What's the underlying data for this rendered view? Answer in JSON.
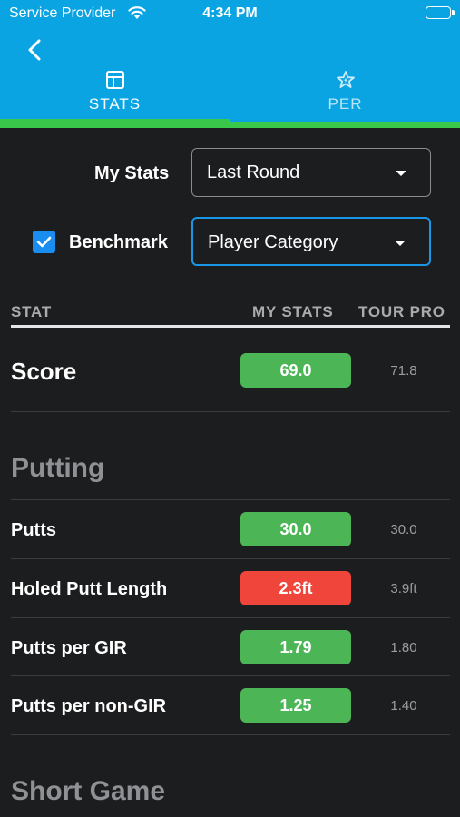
{
  "status_bar": {
    "carrier": "Service Provider",
    "time": "4:34 PM"
  },
  "tabs": [
    {
      "label": "STATS",
      "icon": "table-icon",
      "selected": true
    },
    {
      "label": "PER",
      "icon": "star-sparkle-icon",
      "selected": false
    }
  ],
  "filters": {
    "my_stats_label": "My Stats",
    "my_stats_value": "Last Round",
    "benchmark_label": "Benchmark",
    "benchmark_checked": true,
    "benchmark_value": "Player Category"
  },
  "table_headers": {
    "stat": "STAT",
    "my_stats": "MY STATS",
    "tour_pro": "TOUR PRO"
  },
  "score": {
    "label": "Score",
    "my_stats": "69.0",
    "tour_pro": "71.8",
    "status": "green"
  },
  "putting": {
    "title": "Putting",
    "rows": [
      {
        "label": "Putts",
        "my_stats": "30.0",
        "tour_pro": "30.0",
        "status": "green"
      },
      {
        "label": "Holed Putt Length",
        "my_stats": "2.3ft",
        "tour_pro": "3.9ft",
        "status": "red"
      },
      {
        "label": "Putts per GIR",
        "my_stats": "1.79",
        "tour_pro": "1.80",
        "status": "green"
      },
      {
        "label": "Putts per non-GIR",
        "my_stats": "1.25",
        "tour_pro": "1.40",
        "status": "green"
      }
    ]
  },
  "short_game": {
    "title": "Short Game"
  },
  "colors": {
    "header_bg": "#0aa4e3",
    "tab_indicator": "#39c84a",
    "good": "#4cb556",
    "bad": "#f0453b",
    "background": "#1c1d1f"
  }
}
